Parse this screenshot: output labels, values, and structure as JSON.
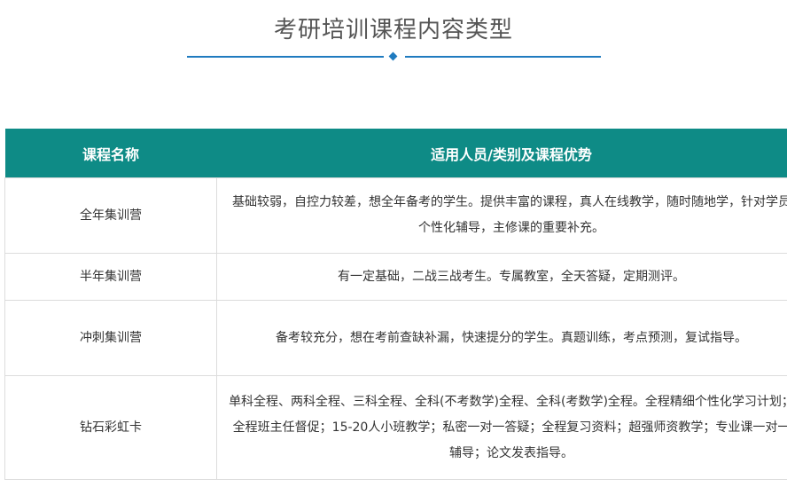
{
  "title": "考研培训课程内容类型",
  "table": {
    "headers": [
      "课程名称",
      "适用人员/类别及课程优势"
    ],
    "rows": [
      {
        "name": "全年集训营",
        "desc": "基础较弱，自控力较差，想全年备考的学生。提供丰富的课程，真人在线教学，随时随地学，针对学员个性化辅导，主修课的重要补充。"
      },
      {
        "name": "半年集训营",
        "desc": "有一定基础，二战三战考生。专属教室，全天答疑，定期测评。"
      },
      {
        "name": "冲刺集训营",
        "desc": "备考较充分，想在考前查缺补漏，快速提分的学生。真题训练，考点预测，复试指导。"
      },
      {
        "name": "钻石彩虹卡",
        "desc": "单科全程、两科全程、三科全程、全科(不考数学)全程、全科(考数学)全程。全程精细个性化学习计划；全程班主任督促；15-20人小班教学；私密一对一答疑；全程复习资料；超强师资教学；专业课一对一辅导；论文发表指导。"
      }
    ]
  },
  "colors": {
    "header_bg": "#0e8b86",
    "divider": "#1f7bbf"
  }
}
